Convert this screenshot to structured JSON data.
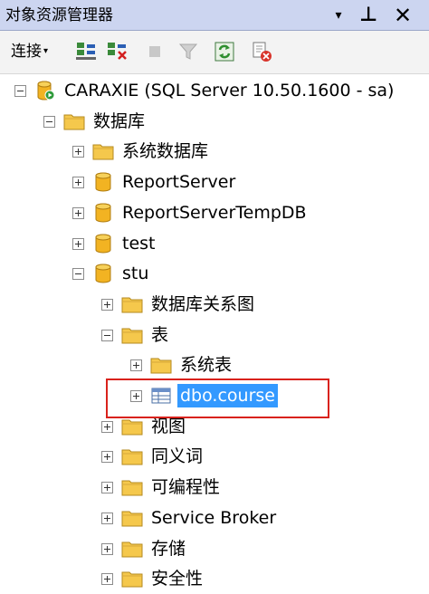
{
  "window": {
    "title": "对象资源管理器",
    "controls": [
      "▾",
      "⊥",
      "✕"
    ]
  },
  "toolbar": {
    "connect_label": "连接",
    "connect_caret": "▾"
  },
  "tree": [
    {
      "label": "CARAXIE (SQL Server 10.50.1600 - sa)",
      "icon": "server-icon",
      "expander": "minus",
      "level": 0
    },
    {
      "label": "数据库",
      "icon": "folder-icon",
      "expander": "minus",
      "level": 1
    },
    {
      "label": "系统数据库",
      "icon": "folder-icon",
      "expander": "plus",
      "level": 2
    },
    {
      "label": "ReportServer",
      "icon": "database-icon",
      "expander": "plus",
      "level": 2
    },
    {
      "label": "ReportServerTempDB",
      "icon": "database-icon",
      "expander": "plus",
      "level": 2
    },
    {
      "label": "test",
      "icon": "database-icon",
      "expander": "plus",
      "level": 2
    },
    {
      "label": "stu",
      "icon": "database-icon",
      "expander": "minus",
      "level": 2
    },
    {
      "label": "数据库关系图",
      "icon": "folder-icon",
      "expander": "plus",
      "level": 3
    },
    {
      "label": "表",
      "icon": "folder-icon",
      "expander": "minus",
      "level": 3
    },
    {
      "label": "系统表",
      "icon": "folder-icon",
      "expander": "plus",
      "level": 4
    },
    {
      "label": "dbo.course",
      "icon": "table-icon",
      "expander": "plus",
      "level": 4,
      "selected": true
    },
    {
      "label": "视图",
      "icon": "folder-icon",
      "expander": "plus",
      "level": 3
    },
    {
      "label": "同义词",
      "icon": "folder-icon",
      "expander": "plus",
      "level": 3
    },
    {
      "label": "可编程性",
      "icon": "folder-icon",
      "expander": "plus",
      "level": 3
    },
    {
      "label": "Service Broker",
      "icon": "folder-icon",
      "expander": "plus",
      "level": 3
    },
    {
      "label": "存储",
      "icon": "folder-icon",
      "expander": "plus",
      "level": 3
    },
    {
      "label": "安全性",
      "icon": "folder-icon",
      "expander": "plus",
      "level": 3
    }
  ],
  "colors": {
    "selection": "#3399ff",
    "annotation_box": "#d9221c",
    "folder": "#f5c84c",
    "database": "#f2b322"
  }
}
